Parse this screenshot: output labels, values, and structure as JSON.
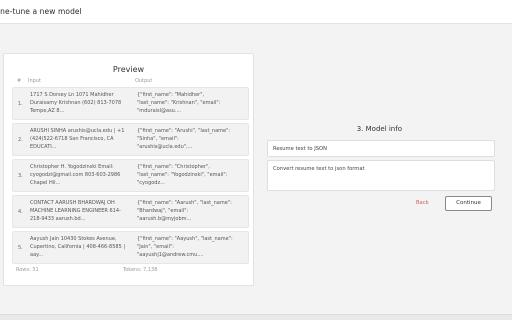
{
  "header": {
    "title": "ine-tune a new model"
  },
  "preview": {
    "title": "Preview",
    "col_num": "#",
    "col_input": "Input",
    "col_output": "Output",
    "rows": [
      {
        "num": "1.",
        "input": "1717 S Dorsey Ln 1071 Mahidher\nDuraisamy Krishnan (602) 813-7078\nTempe,AZ 8...",
        "output": "{\"first_name\": \"Mahidher\",\n\"last_name\": \"Krishnan\", \"email\":\n\"mduraisl@asu...."
      },
      {
        "num": "2.",
        "input": "ARUSHI SINHA arushis@ucla.edu | +1\n(424)522-6718 San Francisco, CA\nEDUCATI...",
        "output": "{\"first_name\": \"Arushi\", \"last_name\":\n\"Sinha\", \"email\":\n\"arushis@ucla.edu\",..."
      },
      {
        "num": "3.",
        "input": "Christopher H. Yogodzinski Email:\ncyogodzi@gmail.com 803-603-2986\nChapel Hil...",
        "output": "{\"first_name\": \"Christopher\",\n\"last_name\": \"Yogodzinski\", \"email\":\n\"cyogodz..."
      },
      {
        "num": "4.",
        "input": "CONTACT AARUSH BHARDWAJ OH\nMACHINE LEARNING ENGINEER 614-\n218-9433 aarush.bd...",
        "output": "{\"first_name\": \"Aarush\", \"last_name\":\n\"Bhardwaj\", \"email\":\n\"aarush.b@myjobm..."
      },
      {
        "num": "5.",
        "input": "Aayush Jain 10430 Stokes Avenue,\nCupertino, California | 408-466-8585 |\naay...",
        "output": "{\"first_name\": \"Aayush\", \"last_name\":\n\"Jain\", \"email\":\n\"aayushj1@andrew.cmu...."
      }
    ],
    "rows_label": "Rows: 31",
    "tokens_label": "Tokens: 7,138"
  },
  "model_info": {
    "section_title": "3. Model info",
    "name_value": "Resume text to JSON",
    "description_value": "Convert resume text to json format",
    "back_label": "Back",
    "continue_label": "Continue"
  }
}
